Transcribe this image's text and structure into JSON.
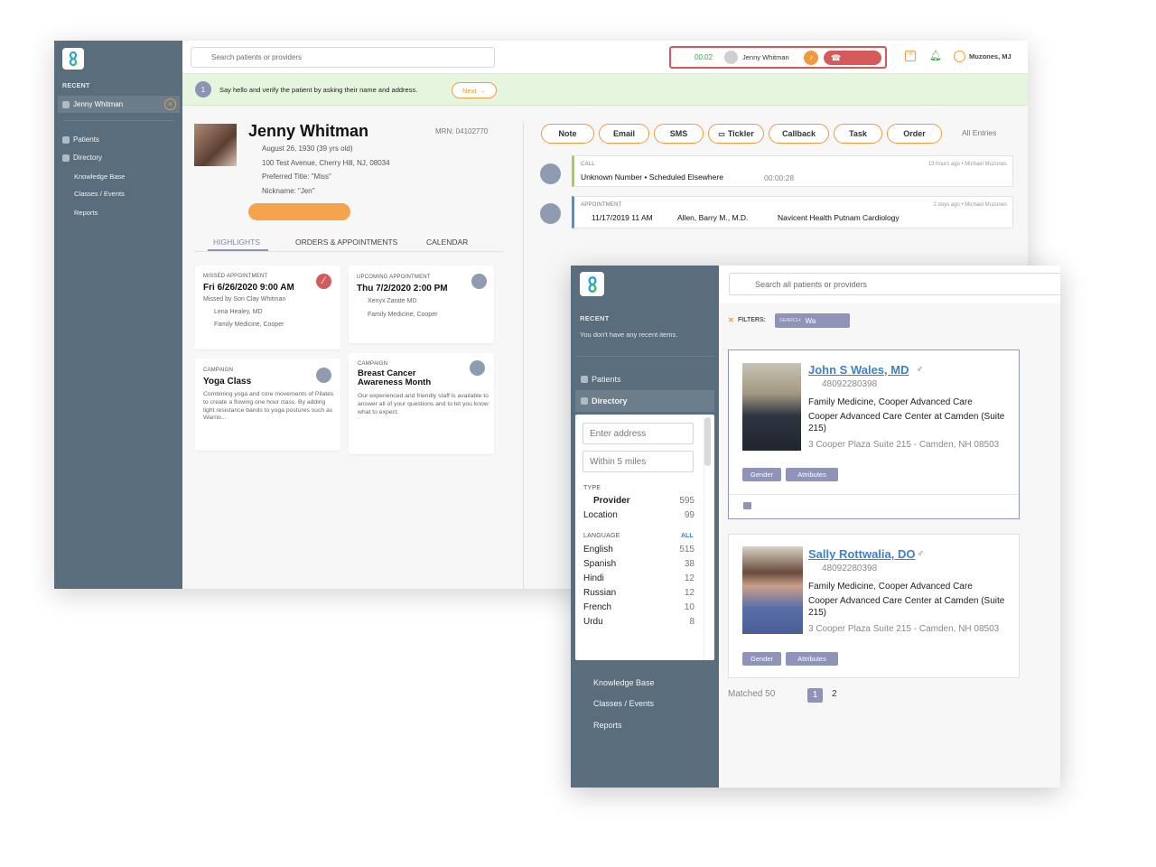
{
  "colors": {
    "sidebar": "#5a6d7c",
    "accent_orange": "#f09a3c",
    "call_red": "#d75a5a",
    "link_blue": "#3b83c9",
    "banner_green": "#e6f6de",
    "tag_purple": "#8f93b8"
  },
  "main": {
    "sidebar": {
      "recent_heading": "RECENT",
      "recent_item": "Jenny Whitman",
      "nav": [
        "Patients",
        "Directory",
        "Knowledge Base",
        "Classes / Events",
        "Reports"
      ]
    },
    "topbar": {
      "search_placeholder": "Search patients or providers",
      "call_timer": "00:02",
      "caller": "Jenny Whitman",
      "user": "Muzones, MJ"
    },
    "banner": {
      "step": "1",
      "text": "Say hello and verify the patient by asking their name and address.",
      "next": "Next"
    },
    "patient": {
      "name": "Jenny Whitman",
      "mrn": "MRN: 04102770",
      "dob": "August 26, 1930 (39 yrs old)",
      "address": "100 Test Avenue, Cherry Hill, NJ, 08034",
      "title": "Preferred Title: \"Miss\"",
      "nickname": "Nickname: \"Jen\""
    },
    "tabs": [
      "HIGHLIGHTS",
      "ORDERS & APPOINTMENTS",
      "CALENDAR"
    ],
    "cards": [
      {
        "cap": "MISSED APPOINTMENT",
        "title": "Fri 6/26/2020 9:00 AM",
        "lines": [
          "Missed by Son Clay Whitman",
          "Lena Healey, MD",
          "Family Medicine, Cooper"
        ]
      },
      {
        "cap": "UPCOMING APPOINTMENT",
        "title": "Thu 7/2/2020 2:00 PM",
        "lines": [
          "Xenyx Zarate MD",
          "Family Medicine, Cooper"
        ]
      },
      {
        "cap": "CAMPAIGN",
        "title": "Yoga Class",
        "body": "Combining yoga and core movements of Pilates to create a flowing one hour class. By adding light resistance bands to yoga postures such as Warrio..."
      },
      {
        "cap": "CAMPAIGN",
        "title": "Breast Cancer Awareness Month",
        "body": "Our experienced and friendly staff is available to answer all of your questions and to let you know what to expect."
      }
    ],
    "actions": [
      "Note",
      "Email",
      "SMS",
      "Tickler",
      "Callback",
      "Task",
      "Order"
    ],
    "all_entries": "All Entries",
    "entries": [
      {
        "type": "CALL",
        "main": "Unknown Number • Scheduled Elsewhere",
        "duration": "00:00:28",
        "meta": "13 hours ago •  Michael Muzones"
      },
      {
        "type": "APPOINTMENT",
        "date": "11/17/2019 11 AM",
        "provider": "Allen, Barry M., M.D.",
        "location": "Navicent Health Putnam Cardiology",
        "meta": "2 days ago •  Michael Muzones"
      }
    ]
  },
  "directory": {
    "sidebar": {
      "recent_heading": "RECENT",
      "recent_empty": "You don't have any recent items.",
      "nav": [
        "Patients",
        "Directory",
        "Knowledge Base",
        "Classes / Events",
        "Reports"
      ]
    },
    "search_placeholder": "Search all patients or providers",
    "filters_label": "FILTERS:",
    "filter_chip_key": "SEARCH:",
    "filter_chip_val": "Wa",
    "filter_panel": {
      "address_placeholder": "Enter address",
      "distance": "Within 5 miles",
      "type_heading": "TYPE",
      "types": [
        {
          "label": "Provider",
          "count": "595"
        },
        {
          "label": "Location",
          "count": "99"
        }
      ],
      "language_heading": "LANGUAGE",
      "language_all": "ALL",
      "languages": [
        {
          "label": "English",
          "count": "515"
        },
        {
          "label": "Spanish",
          "count": "38"
        },
        {
          "label": "Hindi",
          "count": "12"
        },
        {
          "label": "Russian",
          "count": "12"
        },
        {
          "label": "French",
          "count": "10"
        },
        {
          "label": "Urdu",
          "count": "8"
        }
      ]
    },
    "results": [
      {
        "name": "John S Wales, MD",
        "gender": "♂",
        "id": "48092280398",
        "specialty": "Family Medicine, Cooper Advanced Care",
        "center": "Cooper Advanced Care Center at Camden (Suite 215)",
        "address": "3 Cooper Plaza Suite 215 - Camden, NH 08503",
        "tags": [
          "Gender",
          "Attributes"
        ]
      },
      {
        "name": "Sally Rottwalia, DO",
        "gender": "♂",
        "id": "48092280398",
        "specialty": "Family Medicine, Cooper Advanced Care",
        "center": "Cooper Advanced Care Center at Camden (Suite 215)",
        "address": "3 Cooper Plaza Suite 215 - Camden, NH 08503",
        "tags": [
          "Gender",
          "Attributes"
        ]
      }
    ],
    "matched": "Matched 50",
    "pages": [
      "1",
      "2"
    ]
  }
}
